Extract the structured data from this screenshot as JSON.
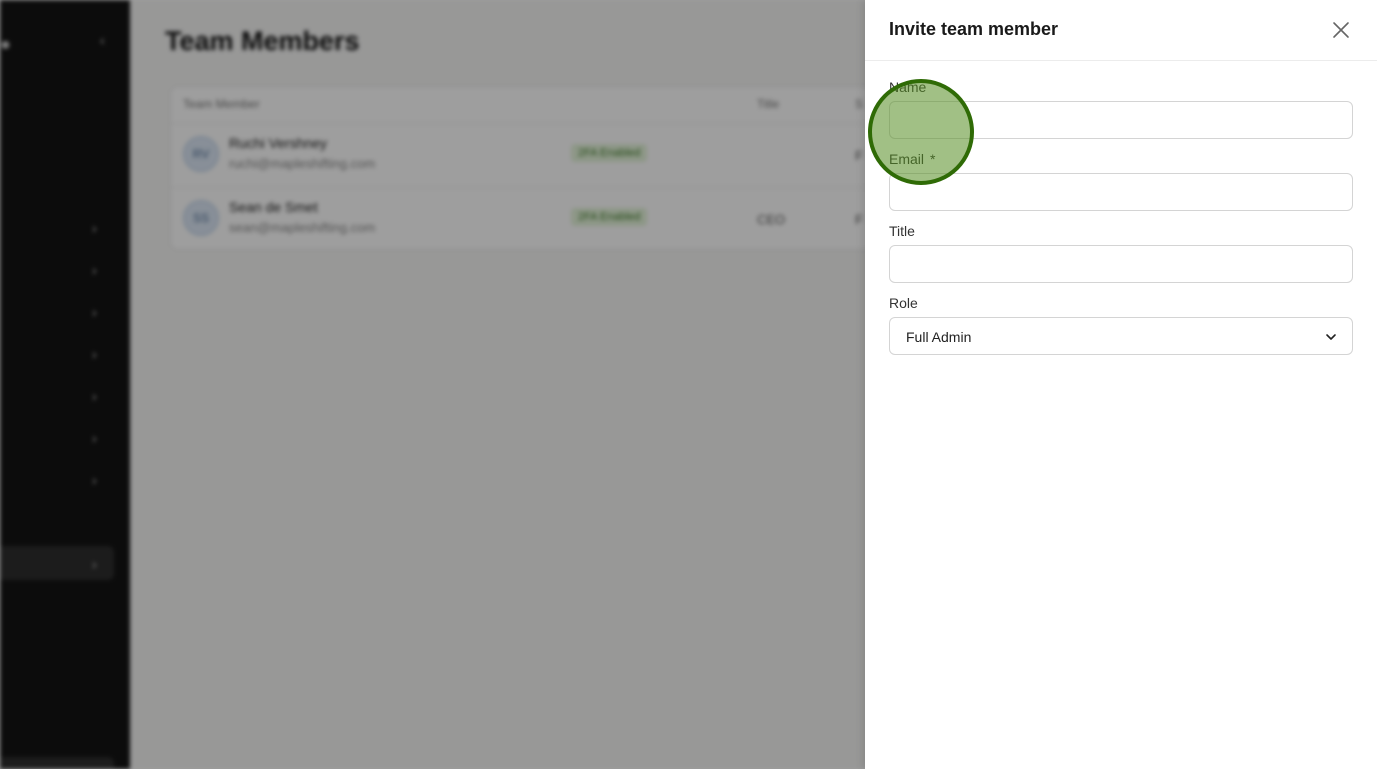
{
  "background": {
    "page_title": "Team Members",
    "table": {
      "headers": {
        "member": "Team Member",
        "title": "Title",
        "col4": "S"
      },
      "rows": [
        {
          "initials": "RV",
          "name": "Ruchi Vershney",
          "email": "ruchi@mapleshifting.com",
          "badge": "2FA Enabled",
          "title": "",
          "col4": "F"
        },
        {
          "initials": "SS",
          "name": "Sean de Smet",
          "email": "sean@mapleshifting.com",
          "badge": "2FA Enabled",
          "title": "CEO",
          "col4": "F"
        }
      ]
    }
  },
  "drawer": {
    "title": "Invite team member",
    "fields": {
      "name": {
        "label": "Name",
        "value": ""
      },
      "email": {
        "label": "Email",
        "required_mark": "*",
        "value": ""
      },
      "title": {
        "label": "Title",
        "value": ""
      },
      "role": {
        "label": "Role",
        "value": "Full Admin"
      }
    }
  },
  "colors": {
    "sidebar": "#141414",
    "overlay": "rgba(0,0,0,0.38)",
    "click_marker": "#2f6b06"
  },
  "icons": {
    "close": "close-icon",
    "chevron": "chevron-down-icon"
  }
}
